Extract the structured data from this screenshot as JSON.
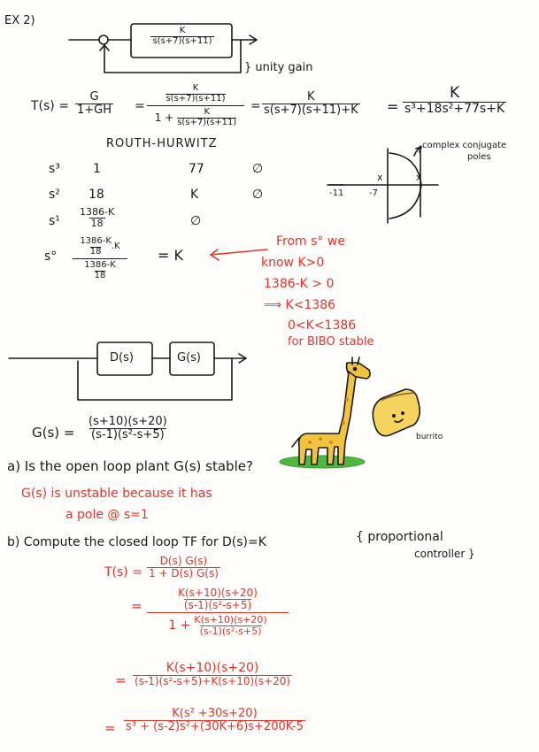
{
  "colors": {
    "ink": "#1a1a1a",
    "red": "#e5322d",
    "paper": "#fffefa",
    "giraffe": "#f2c33d",
    "grass": "#4fb83f",
    "burrito": "#f4d35e"
  },
  "ex2": {
    "heading": "EX 2)",
    "block1_num": "K",
    "block1_den": "s(s+7)(s+11)",
    "unity_note": "} unity gain",
    "T_lhs": "T(s) =",
    "f1_num": "G",
    "f1_den": "1+GH",
    "eq": "=",
    "f2_num_num": "K",
    "f2_num_den": "s(s+7)(s+11)",
    "f2_den_prefix": "1 +",
    "f2_den_num": "K",
    "f2_den_den": "s(s+7)(s+11)",
    "f3_num": "K",
    "f3_den": "s(s+7)(s+11)+K",
    "f4_num": "K",
    "f4_den": "s³+18s²+77s+K"
  },
  "routh": {
    "title": "ROUTH-HURWITZ",
    "rows": [
      {
        "label": "s³",
        "c1": "1",
        "c2": "77",
        "c3": "∅"
      },
      {
        "label": "s²",
        "c1": "18",
        "c2": "K",
        "c3": "∅"
      },
      {
        "label": "s¹",
        "c1_num": "1386-K",
        "c1_den": "18",
        "c2": "∅"
      },
      {
        "label": "s°",
        "top_num": "1386-K",
        "top_den": "18",
        "top_mul": ".K",
        "bot_num": "1386-K",
        "bot_den": "18",
        "result": "= K"
      }
    ]
  },
  "root_locus": {
    "annotation_line1": "complex conjugate",
    "annotation_line2": "poles",
    "tick1": "-11",
    "tick2": "-7"
  },
  "stability_notes": [
    "From s° we",
    "know  K>0",
    "1386-K > 0",
    "⟹ K<1386",
    "0<K<1386",
    "for BIBO stable"
  ],
  "block2": {
    "D_label": "D(s)",
    "G_label": "G(s)"
  },
  "G_def": {
    "lhs": "G(s) =",
    "num": "(s+10)(s+20)",
    "den": "(s-1)(s²-s+5)"
  },
  "burrito_label": "burrito",
  "q_a": {
    "question": "a) Is the open loop plant G(s) stable?",
    "answer_line1": "G(s) is unstable because it has",
    "answer_line2": "a pole @ s=1"
  },
  "q_b": {
    "question": "b) Compute the closed loop TF for D(s)=K",
    "brace_note_line1": "{ proportional",
    "brace_note_line2": "controller }",
    "T_lhs": "T(s) =",
    "l1_num": "D(s) G(s)",
    "l1_den": "1 + D(s) G(s)",
    "eq": "=",
    "l2_top_num": "K(s+10)(s+20)",
    "l2_top_den": "(s-1)(s²-s+5)",
    "l2_bot_prefix": "1 +",
    "l2_bot_num": "K(s+10)(s+20)",
    "l2_bot_den": "(s-1)(s²-s+5)",
    "l3_num": "K(s+10)(s+20)",
    "l3_den": "(s-1)(s²-s+5)+K(s+10)(s+20)",
    "l4_num": "K(s² +30s+20)",
    "l4_den": "s³ + (s-2)s²+(30K+6)s+200K-5"
  }
}
